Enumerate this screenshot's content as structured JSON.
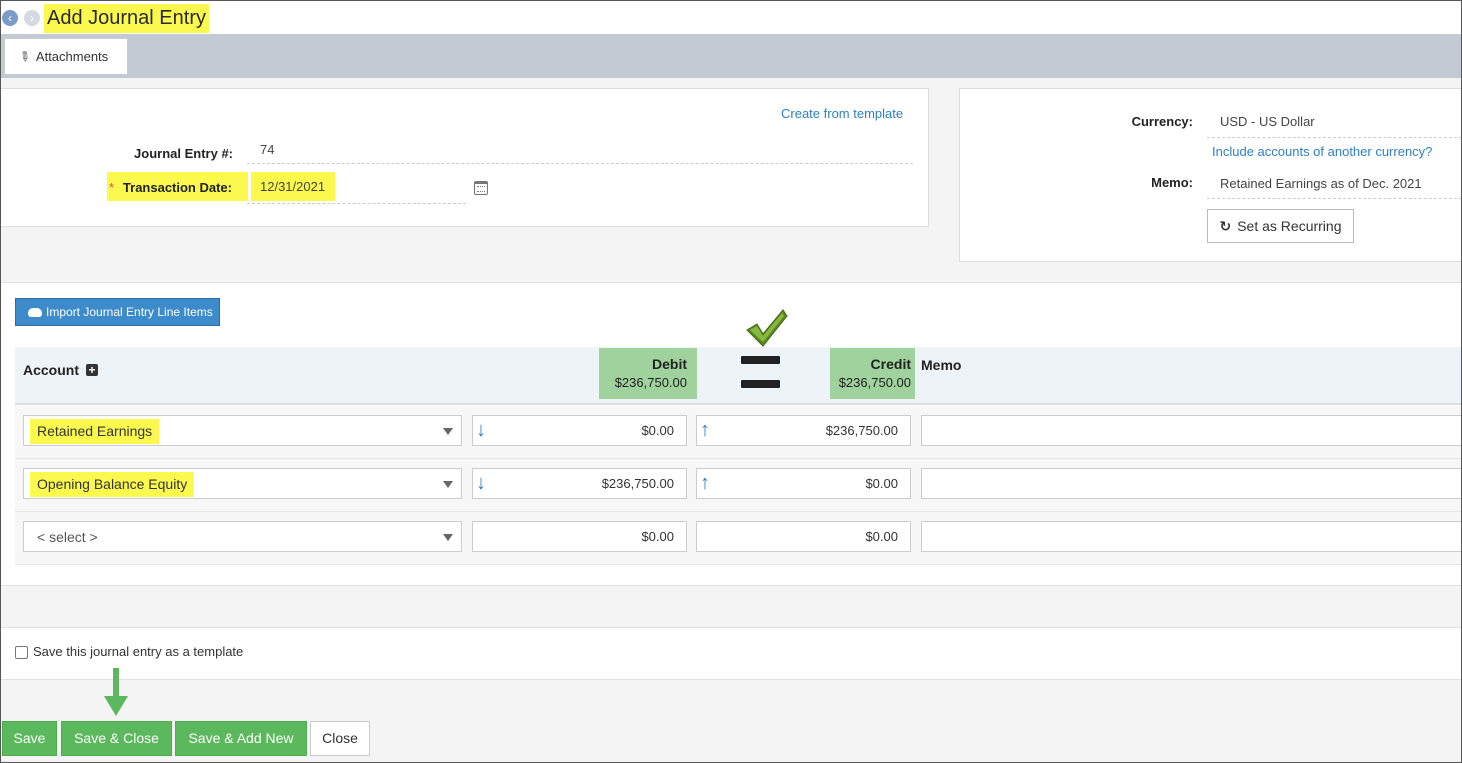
{
  "title": "Add Journal Entry",
  "tabs": {
    "attachments": "Attachments"
  },
  "header": {
    "create_from_template": "Create from template",
    "journal_entry_label": "Journal Entry #:",
    "journal_entry_value": "74",
    "transaction_date_required": "*",
    "transaction_date_label": "Transaction Date:",
    "transaction_date_value": "12/31/2021",
    "currency_label": "Currency:",
    "currency_value": "USD - US Dollar",
    "include_currency_link": "Include accounts of another currency?",
    "memo_label": "Memo:",
    "memo_value": "Retained Earnings as of Dec. 2021",
    "set_recurring": "Set as Recurring"
  },
  "import_button": "Import Journal Entry Line Items",
  "table": {
    "col_account": "Account",
    "col_debit": "Debit",
    "debit_total": "$236,750.00",
    "col_credit": "Credit",
    "credit_total": "$236,750.00",
    "col_memo": "Memo",
    "rows": [
      {
        "account": "Retained Earnings",
        "debit": "$0.00",
        "credit": "$236,750.00",
        "memo": ""
      },
      {
        "account": "Opening Balance Equity",
        "debit": "$236,750.00",
        "credit": "$0.00",
        "memo": ""
      },
      {
        "account": "< select >",
        "debit": "$0.00",
        "credit": "$0.00",
        "memo": ""
      }
    ]
  },
  "template_checkbox_label": "Save this journal entry as a template",
  "footer": {
    "save": "Save",
    "save_close": "Save & Close",
    "save_add_new": "Save & Add New",
    "close": "Close"
  },
  "colors": {
    "highlight": "#fbf94e",
    "green_button": "#5cb85c",
    "link_blue": "#2f7fc5",
    "total_green": "#9fd29c"
  }
}
